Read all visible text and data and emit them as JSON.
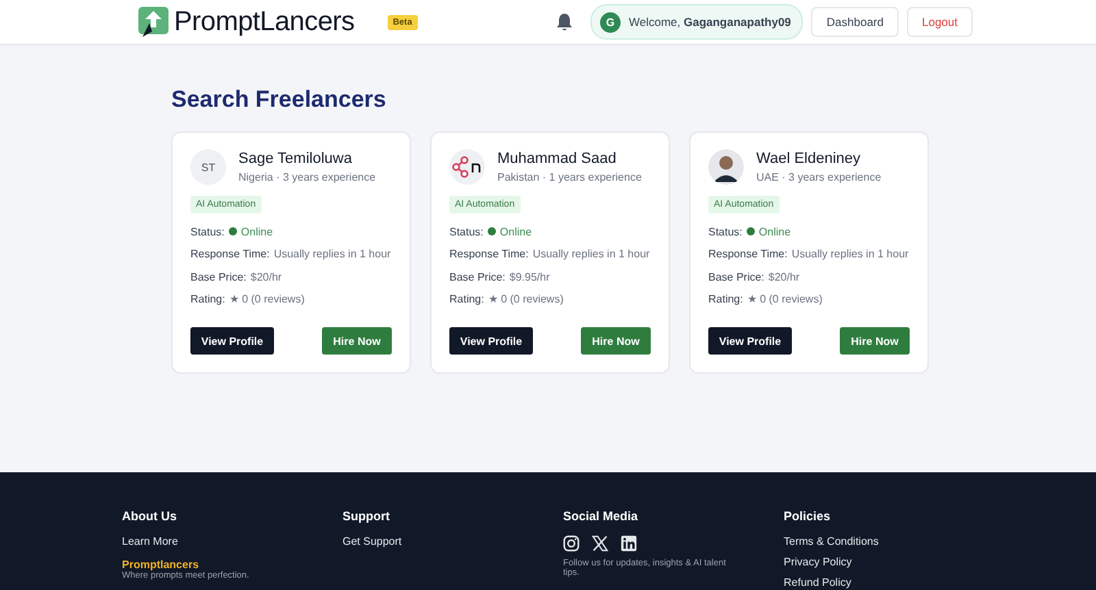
{
  "header": {
    "logo_text": "PromptLancers",
    "badge": "Beta",
    "user_initial": "G",
    "welcome": "Welcome, **Gaganganapathy09**",
    "buttons": [
      {
        "label": "Dashboard",
        "kind": "neutral"
      },
      {
        "label": "Logout",
        "kind": "danger"
      }
    ]
  },
  "page_title": "Search Freelancers",
  "freelancers": [
    {
      "name": "Sage Temiloluwa",
      "avatar": {
        "kind": "initials",
        "text": "ST"
      },
      "subtitle": "Nigeria · 3 years experience",
      "tag": "AI Automation",
      "details": [
        {
          "kind": "status",
          "label": "Status:",
          "value": "Online",
          "online": true
        },
        {
          "kind": "text",
          "label": "Response Time:",
          "value": "Usually replies in 1 hour"
        },
        {
          "kind": "text",
          "label": "Base Price:",
          "value": "$20/hr"
        },
        {
          "kind": "text",
          "label": "Rating:",
          "value": "★ 0 (0 reviews)"
        }
      ],
      "buttons": [
        "View Profile",
        "Hire Now"
      ]
    },
    {
      "name": "Muhammad Saad",
      "avatar": {
        "kind": "logo"
      },
      "subtitle": "Pakistan · 1 years experience",
      "tag": "AI Automation",
      "details": [
        {
          "kind": "status",
          "label": "Status:",
          "value": "Online",
          "online": true
        },
        {
          "kind": "text",
          "label": "Response Time:",
          "value": "Usually replies in 1 hour"
        },
        {
          "kind": "text",
          "label": "Base Price:",
          "value": "$9.95/hr"
        },
        {
          "kind": "text",
          "label": "Rating:",
          "value": "★ 0 (0 reviews)"
        }
      ],
      "buttons": [
        "View Profile",
        "Hire Now"
      ]
    },
    {
      "name": "Wael Eldeniney",
      "avatar": {
        "kind": "photo"
      },
      "subtitle": "UAE · 3 years experience",
      "tag": "AI Automation",
      "details": [
        {
          "kind": "status",
          "label": "Status:",
          "value": "Online",
          "online": true
        },
        {
          "kind": "text",
          "label": "Response Time:",
          "value": "Usually replies in 1 hour"
        },
        {
          "kind": "text",
          "label": "Base Price:",
          "value": "$20/hr"
        },
        {
          "kind": "text",
          "label": "Rating:",
          "value": "★ 0 (0 reviews)"
        }
      ],
      "buttons": [
        "View Profile",
        "Hire Now"
      ]
    }
  ],
  "footer": {
    "columns": [
      {
        "heading": "About Us",
        "links": [
          "Learn More"
        ],
        "brand": "Promptlancers",
        "tagline": "Where prompts meet perfection."
      },
      {
        "heading": "Support",
        "links": [
          "Get Support"
        ]
      },
      {
        "heading": "Social Media",
        "note": "Follow us for updates, insights & AI talent tips."
      },
      {
        "heading": "Policies",
        "links": [
          "Terms & Conditions",
          "Privacy Policy",
          "Refund Policy"
        ]
      }
    ]
  }
}
